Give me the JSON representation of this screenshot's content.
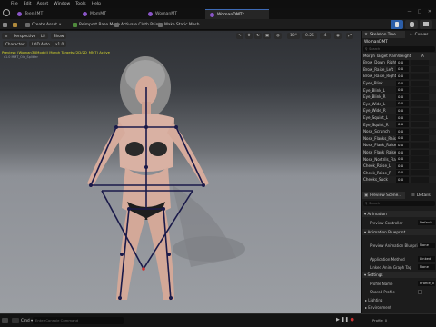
{
  "menu": [
    "File",
    "Edit",
    "Asset",
    "Window",
    "Tools",
    "Help"
  ],
  "tabs": [
    {
      "label": "Teen2MT"
    },
    {
      "label": "MomMT"
    },
    {
      "label": "WomanMT"
    },
    {
      "label": "WomanDMT*",
      "active": true
    }
  ],
  "window_controls": [
    "—",
    "□",
    "✕"
  ],
  "toolbar": {
    "save": "",
    "create_asset": "Create Asset",
    "reimport": "Reimport Base Mesh",
    "activate_cloth": "Activate Cloth Paint",
    "make_static": "Make Static Mesh"
  },
  "viewport": {
    "btn_perspective": "Perspective",
    "btn_lit": "Lit",
    "btn_character": "Character",
    "btn_lod": "LOD Auto",
    "btn_speed": "x1.0",
    "icon_labels": [
      "10°",
      "0.25",
      "4"
    ],
    "warning": "Preview: (Woman3DModel) Morph Targets (2D/2D_MMT) Active",
    "info": "x1.0 MMT_Old_Splitter"
  },
  "panels": {
    "skeleton_tree": "Skeleton Tree",
    "curves": "Curves",
    "asset_name": "WomanDMT",
    "search_placeholder": "Search",
    "col_name": "Morph Target Name",
    "col_weight": "Weight",
    "col_a": "A",
    "morph_targets": [
      {
        "name": "Brow_Down_Right",
        "weight": "0.0"
      },
      {
        "name": "Brow_Raise_Left",
        "weight": "0.0"
      },
      {
        "name": "Brow_Raise_Right",
        "weight": "0.0"
      },
      {
        "name": "Eyes_Blink",
        "weight": "0.0"
      },
      {
        "name": "Eye_Blink_L",
        "weight": "0.0"
      },
      {
        "name": "Eye_Blink_R",
        "weight": "0.0"
      },
      {
        "name": "Eye_Wide_L",
        "weight": "0.0"
      },
      {
        "name": "Eye_Wide_R",
        "weight": "0.0"
      },
      {
        "name": "Eye_Squint_L",
        "weight": "0.0"
      },
      {
        "name": "Eye_Squint_R",
        "weight": "0.0"
      },
      {
        "name": "Nose_Scrunch",
        "weight": "0.0"
      },
      {
        "name": "Nose_Flanks_Raise",
        "weight": "0.0"
      },
      {
        "name": "Nose_Flank_Raise_L",
        "weight": "0.0"
      },
      {
        "name": "Nose_Flank_Raise_R",
        "weight": "0.0"
      },
      {
        "name": "Nose_Nostrils_Flare",
        "weight": "0.0"
      },
      {
        "name": "Cheek_Raise_L",
        "weight": "0.0"
      },
      {
        "name": "Cheek_Raise_R",
        "weight": "0.0"
      },
      {
        "name": "Cheeks_Suck",
        "weight": "0.0"
      }
    ],
    "preview_scene": "Preview Scene...",
    "details": "Details",
    "details_search": "Search",
    "animation_section": "Animation",
    "preview_controller_label": "Preview Controller",
    "preview_controller_value": "Default",
    "anim_blueprint_section": "Animation Blueprint",
    "preview_bp_label": "Preview Animation Blueprint",
    "preview_bp_value": "None",
    "application_method_label": "Application Method",
    "application_method_value": "Linked",
    "linked_anim_label": "Linked Anim Graph Tag",
    "linked_anim_value": "None",
    "settings_section": "Settings",
    "profile_name_label": "Profile Name",
    "profile_name_value": "Profile_0",
    "shared_profile_label": "Shared Profile",
    "lighting_section": "Lighting",
    "env_section": "Environment",
    "profile_footer": "Profile_0"
  },
  "bottom": {
    "cmd_label": "Cmd",
    "cmd_placeholder": "Enter Console Command",
    "derived_data": "Derived Data",
    "source_control": "Source Control"
  },
  "colors": {
    "accent_blue": "#3d6ab5",
    "bone_color": "#1a1a4a",
    "warning_yellow": "#d7d72c"
  }
}
